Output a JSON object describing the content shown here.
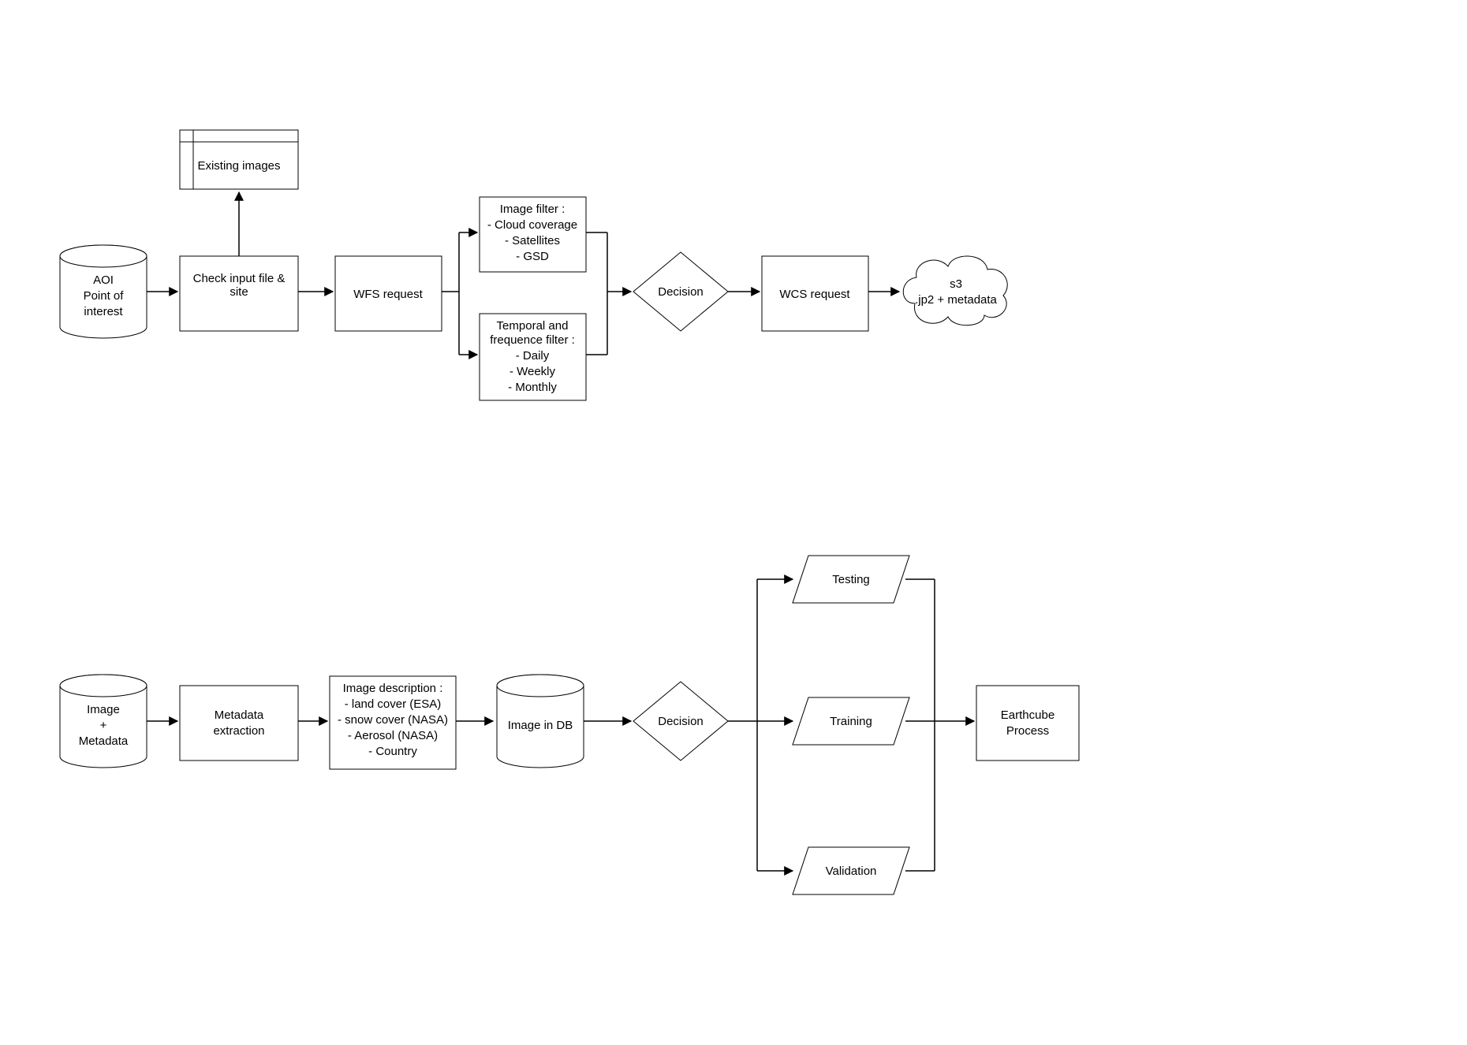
{
  "pipeline1": {
    "aoi": {
      "line1": "AOI",
      "line2": "Point of",
      "line3": "interest"
    },
    "existing": "Existing images",
    "check": "Check input file & site",
    "wfs": "WFS request",
    "imgfilter": {
      "title": "Image filter :",
      "i1": "- Cloud coverage",
      "i2": "- Satellites",
      "i3": "- GSD"
    },
    "tempfilter": {
      "title": "Temporal and",
      "subtitle": "frequence filter :",
      "i1": "- Daily",
      "i2": "- Weekly",
      "i3": "- Monthly"
    },
    "decision": "Decision",
    "wcs": "WCS request",
    "s3": {
      "line1": "s3",
      "line2": ".jp2 + metadata"
    }
  },
  "pipeline2": {
    "image": {
      "line1": "Image",
      "line2": "+",
      "line3": "Metadata"
    },
    "metadata": {
      "line1": "Metadata",
      "line2": "extraction"
    },
    "desc": {
      "title": "Image description :",
      "i1": "- land cover (ESA)",
      "i2": "- snow cover (NASA)",
      "i3": "- Aerosol (NASA)",
      "i4": "- Country"
    },
    "imagedb": "Image in DB",
    "decision": "Decision",
    "testing": "Testing",
    "training": "Training",
    "validation": "Validation",
    "earthcube": {
      "line1": "Earthcube",
      "line2": "Process"
    }
  }
}
